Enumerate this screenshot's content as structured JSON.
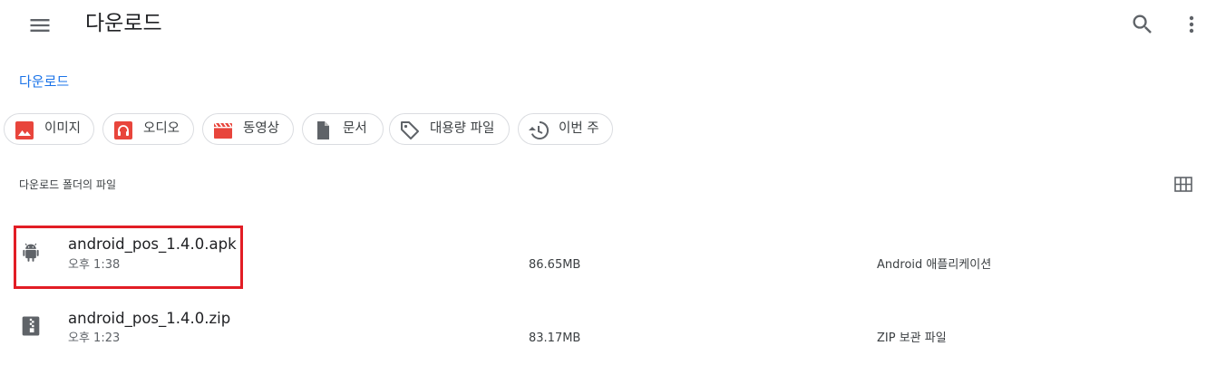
{
  "header": {
    "title": "다운로드",
    "menu_icon": "menu-icon",
    "search_icon": "search-icon",
    "more_icon": "more-vert-icon"
  },
  "breadcrumb": "다운로드",
  "filters": [
    {
      "label": "이미지",
      "icon": "image-icon",
      "color": "#e8453c"
    },
    {
      "label": "오디오",
      "icon": "headphones-icon",
      "color": "#e8453c"
    },
    {
      "label": "동영상",
      "icon": "movie-icon",
      "color": "#e8453c"
    },
    {
      "label": "문서",
      "icon": "document-icon",
      "color": "#5f6368"
    },
    {
      "label": "대용량 파일",
      "icon": "tag-icon",
      "color": "#5f6368"
    },
    {
      "label": "이번 주",
      "icon": "history-icon",
      "color": "#5f6368"
    }
  ],
  "section_label": "다운로드 폴더의 파일",
  "view_toggle_icon": "grid-view-icon",
  "files": [
    {
      "name": "android_pos_1.4.0.apk",
      "date": "오후 1:38",
      "size": "86.65MB",
      "type": "Android 애플리케이션",
      "icon": "android-icon"
    },
    {
      "name": "android_pos_1.4.0.zip",
      "date": "오후 1:23",
      "size": "83.17MB",
      "type": "ZIP 보관 파일",
      "icon": "zip-icon"
    }
  ],
  "colors": {
    "accent": "#1a73e8",
    "highlight": "#e21d25",
    "chip_border": "#dadce0"
  }
}
